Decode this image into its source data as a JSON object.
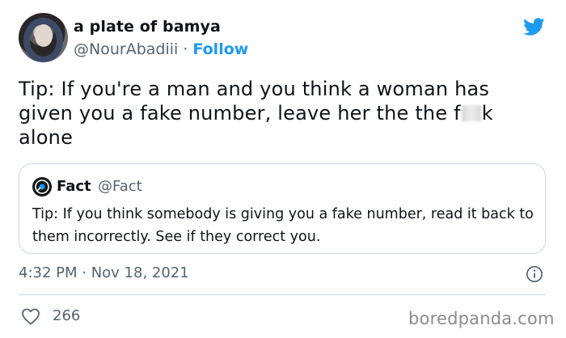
{
  "author": {
    "display_name": "a plate of bamya",
    "handle": "@NourAbadiii",
    "separator": " · ",
    "follow_label": "Follow"
  },
  "tweet": {
    "text_before": "Tip: If you're a man and you think a woman has given you a fake number, leave her the the f",
    "text_after": "k alone"
  },
  "quoted": {
    "name": "Fact",
    "handle": "@Fact",
    "text": "Tip: If you think somebody is giving you a fake number, read it back to them incorrectly. See if they correct you."
  },
  "timestamp": "4:32 PM · Nov 18, 2021",
  "likes": "266",
  "watermark": "boredpanda.com",
  "icons": {
    "brand": "twitter-bird-icon",
    "info": "info-icon",
    "like": "heart-icon"
  },
  "colors": {
    "twitter_blue": "#1d9bf0",
    "secondary_text": "#536471",
    "border": "#cfd9de"
  }
}
